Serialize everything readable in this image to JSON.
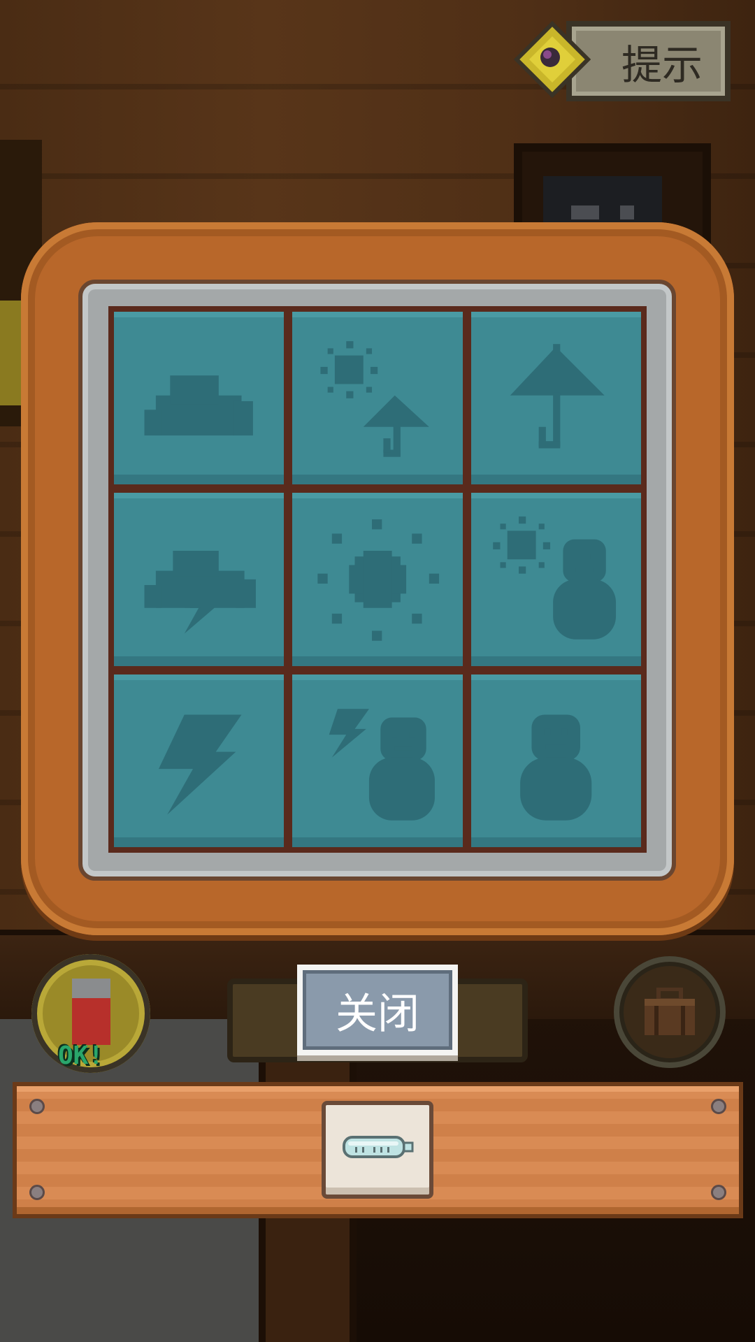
{
  "header": {
    "hint_label": "提示"
  },
  "puzzle": {
    "tiles": [
      {
        "icon": "cloud-icon"
      },
      {
        "icon": "sun-umbrella-icon"
      },
      {
        "icon": "umbrella-icon"
      },
      {
        "icon": "thunderstorm-icon"
      },
      {
        "icon": "sun-icon"
      },
      {
        "icon": "sun-snowman-icon"
      },
      {
        "icon": "lightning-icon"
      },
      {
        "icon": "lightning-snowman-icon"
      },
      {
        "icon": "snowman-icon"
      }
    ]
  },
  "controls": {
    "close_label": "关闭",
    "status_badge_text": "OK!"
  },
  "inventory": {
    "items": [
      {
        "icon": "thermometer-icon"
      }
    ]
  },
  "colors": {
    "tile": "#3e8a93",
    "tile_icon": "#2e6d77",
    "frame": "#b8672a",
    "close_button": "#8a9aab"
  }
}
